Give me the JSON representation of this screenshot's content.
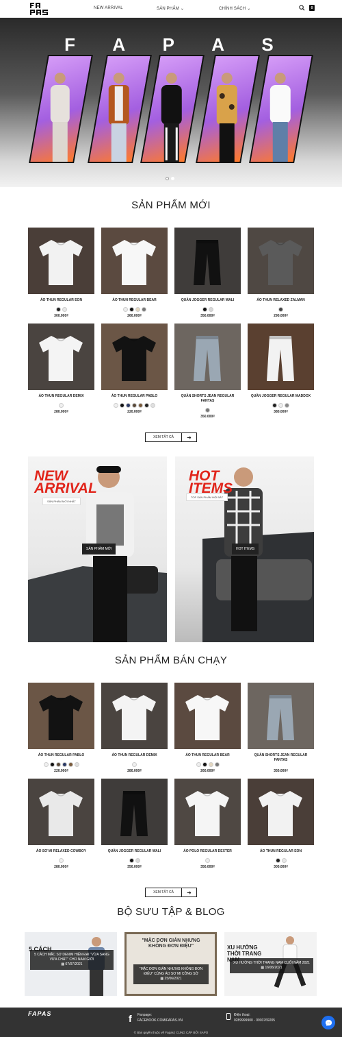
{
  "brand": {
    "logo": "FAPAS"
  },
  "nav": {
    "new_arrival": "NEW ARRIVAL",
    "products": "SẢN PHẨM",
    "policy": "CHÍNH SÁCH",
    "cart_count": "0"
  },
  "hero": {
    "word": [
      "F",
      "A",
      "P",
      "A",
      "S"
    ]
  },
  "new_products": {
    "title": "SẢN PHẨM MỚI",
    "items": [
      {
        "name": "ÁO THUN REGULAR EON",
        "price": "300.000₫",
        "swatches": [
          "#222222",
          "#e8e8e8"
        ],
        "bg": "#4a3e38",
        "shirt": "#f2f2f2"
      },
      {
        "name": "ÁO THUN REGULAR BEAR",
        "price": "260.000₫",
        "swatches": [
          "#eeeeee",
          "#111111",
          "#e4d7bf",
          "#777777"
        ],
        "bg": "#5b4a40",
        "shirt": "#f7f7f7"
      },
      {
        "name": "QUẦN JOGGER REGULAR WALI",
        "price": "350.000₫",
        "swatches": [
          "#111111",
          "#d8d8d8"
        ],
        "bg": "#3f3c3a",
        "shirt": "#111111"
      },
      {
        "name": "ÁO THUN RELAXED ZALMAN",
        "price": "290.000₫",
        "swatches": [
          "#444444"
        ],
        "bg": "#4f4843",
        "shirt": "#5a5a5a"
      },
      {
        "name": "ÁO THUN REGULAR DEMIX",
        "price": "280.000₫",
        "swatches": [
          "#f0f0f0"
        ],
        "bg": "#4a4440",
        "shirt": "#f4f4f4"
      },
      {
        "name": "ÁO THUN REGULAR PABLO",
        "price": "220.000₫",
        "swatches": [
          "#f0f0f0",
          "#111111",
          "#2b3a66",
          "#5a4a3a",
          "#7a5a3a",
          "#222222",
          "#e0e0e0"
        ],
        "bg": "#6b5646",
        "shirt": "#121212"
      },
      {
        "name": "QUẦN SHORTS JEAN REGULAR FANTAS",
        "price": "350.000₫",
        "swatches": [
          "#777777"
        ],
        "bg": "#6d6660",
        "shirt": "#9aa7b3"
      },
      {
        "name": "QUẦN JOGGER REGULAR MADDOX",
        "price": "380.000₫",
        "swatches": [
          "#222222",
          "#eeeeee",
          "#888888"
        ],
        "bg": "#5a4030",
        "shirt": "#f2f2f2"
      }
    ],
    "more": "XEM TẤT CẢ"
  },
  "banners": [
    {
      "title_line1": "NEW",
      "title_line2": "ARRIVAL",
      "sub": "SẢN PHẨM MỚI NHẤT",
      "button": "SẢN PHẨM MỚI"
    },
    {
      "title_line1": "HOT",
      "title_line2": "ITEMS",
      "sub": "TOP SẢN PHẨM HỘI BÁT",
      "button": "HOT ITEMS"
    }
  ],
  "best_sellers": {
    "title": "SẢN PHẨM BÁN CHẠY",
    "items": [
      {
        "name": "ÁO THUN REGULAR PABLO",
        "price": "220.000₫",
        "swatches": [
          "#f0f0f0",
          "#111111",
          "#5a4a3a",
          "#2b3a66",
          "#7a5a3a",
          "#e0e0e0"
        ],
        "bg": "#6b5646",
        "shirt": "#121212"
      },
      {
        "name": "ÁO THUN REGULAR DEMIX",
        "price": "280.000₫",
        "swatches": [
          "#f0f0f0"
        ],
        "bg": "#4a4440",
        "shirt": "#f4f4f4"
      },
      {
        "name": "ÁO THUN REGULAR BEAR",
        "price": "260.000₫",
        "swatches": [
          "#eeeeee",
          "#111111",
          "#e4d7bf",
          "#777777"
        ],
        "bg": "#5b4a40",
        "shirt": "#f7f7f7"
      },
      {
        "name": "QUẦN SHORTS JEAN REGULAR FANTAS",
        "price": "350.000₫",
        "swatches": [],
        "bg": "#6d6660",
        "shirt": "#9aa7b3"
      },
      {
        "name": "ÁO SƠ MI RELAXED COWBOY",
        "price": "280.000₫",
        "swatches": [
          "#f0f0f0"
        ],
        "bg": "#4a4440",
        "shirt": "#e9e9e9"
      },
      {
        "name": "QUẦN JOGGER REGULAR WALI",
        "price": "350.000₫",
        "swatches": [
          "#111111",
          "#d8d8d8"
        ],
        "bg": "#3f3c3a",
        "shirt": "#111111"
      },
      {
        "name": "ÁO POLO REGULAR DEXTER",
        "price": "350.000₫",
        "swatches": [
          "#eeeeee"
        ],
        "bg": "#4f4843",
        "shirt": "#f5f5f5"
      },
      {
        "name": "ÁO THUN REGULAR EON",
        "price": "300.000₫",
        "swatches": [
          "#222222",
          "#e8e8e8"
        ],
        "bg": "#4a3e38",
        "shirt": "#f2f2f2"
      }
    ],
    "more": "XEM TẤT CẢ"
  },
  "blog": {
    "title": "BỘ SƯU TẬP & BLOG",
    "posts": [
      {
        "overlay": "5 CÁCH",
        "title": "5 CÁCH MẶC SƠ DENIM HIỆN ĐẠI \"VỪA SANG VỪA CHẤT\" CHO NAM GIỚI",
        "date": "07/07/2021"
      },
      {
        "overlay": "\"MẶC ĐƠN GIẢN NHƯNG KHÔNG ĐƠN ĐIỆU\"",
        "title": "\"MẶC ĐƠN GIẢN NHƯNG KHÔNG ĐƠN ĐIỆU\" CÙNG ÁO SƠ MI CÔNG SỞ",
        "date": "25/06/2021"
      },
      {
        "overlay": "XU HƯỚNG THỜI TRANG NAM",
        "title": "XU HƯỚNG THỜI TRANG NAM CUỐI NĂM 2021",
        "date": "16/06/2021"
      }
    ]
  },
  "footer": {
    "logo": "FAPAS",
    "fanpage_label": "Fanpage:",
    "fanpage": "FACEBOOK.COM/FAPAS.VN",
    "phone_label": "Điện thoại:",
    "phone": "0289999900 - 0903769205",
    "copyright": "© Bản quyền thuộc về Fapas | CUNG CẤP BỞI SAPO"
  }
}
